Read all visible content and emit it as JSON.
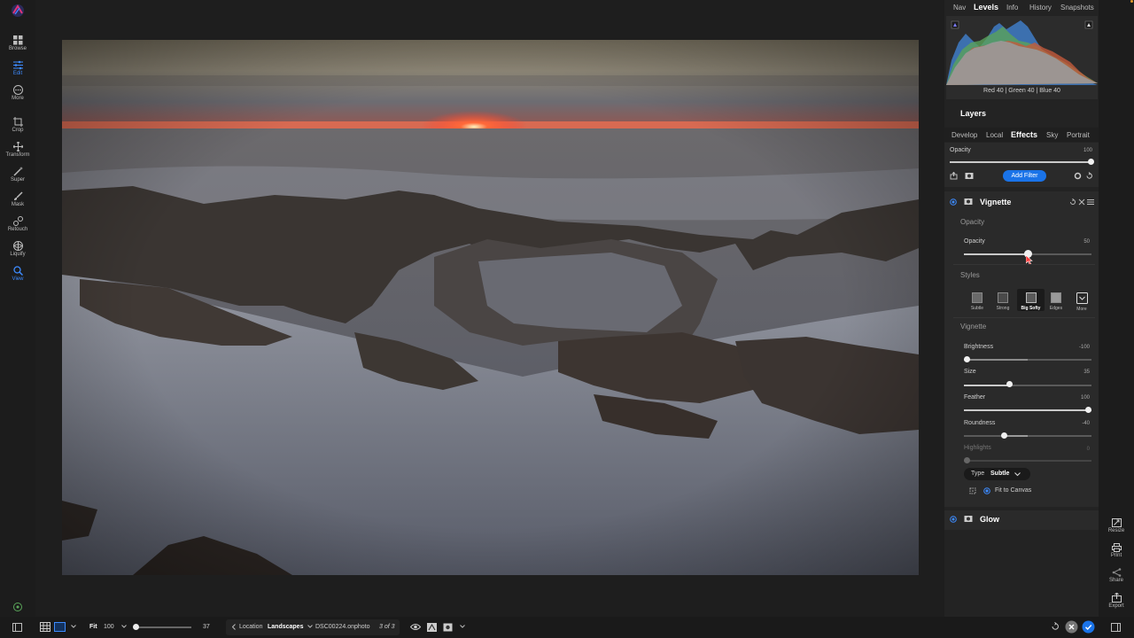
{
  "left_tools": [
    {
      "label": "Browse",
      "icon": "grid-icon"
    },
    {
      "label": "Edit",
      "icon": "sliders-icon",
      "active": true
    },
    {
      "label": "More",
      "icon": "ellipsis-circle-icon"
    },
    {
      "label": "Crop",
      "icon": "crop-icon"
    },
    {
      "label": "Transform",
      "icon": "move-icon"
    },
    {
      "label": "Super",
      "icon": "magic-wand-icon"
    },
    {
      "label": "Mask",
      "icon": "brush-icon"
    },
    {
      "label": "Retouch",
      "icon": "retouch-icon"
    },
    {
      "label": "Liquify",
      "icon": "liquify-icon"
    },
    {
      "label": "View",
      "icon": "magnifier-icon",
      "active": true
    }
  ],
  "top_tabs": [
    {
      "label": "Nav"
    },
    {
      "label": "Levels",
      "active": true
    },
    {
      "label": "Info"
    },
    {
      "label": "History"
    },
    {
      "label": "Snapshots"
    }
  ],
  "histogram": {
    "readout": "Red  40  | Green  40  | Blue  40"
  },
  "layers_title": "Layers",
  "module_tabs": [
    {
      "label": "Develop"
    },
    {
      "label": "Local"
    },
    {
      "label": "Effects",
      "active": true
    },
    {
      "label": "Sky"
    },
    {
      "label": "Portrait"
    }
  ],
  "filter_opacity": {
    "label": "Opacity",
    "value": "100",
    "level": 1.0
  },
  "add_filter_label": "Add Filter",
  "vignette": {
    "title": "Vignette",
    "opacity_section": "Opacity",
    "opacity": {
      "label": "Opacity",
      "value": "50",
      "level": 0.5
    },
    "styles_section": "Styles",
    "styles": [
      {
        "label": "Subtle"
      },
      {
        "label": "Strong"
      },
      {
        "label": "Big Softy",
        "selected": true
      },
      {
        "label": "Edges"
      },
      {
        "label": "More"
      }
    ],
    "vignette_section": "Vignette",
    "sliders": [
      {
        "label": "Brightness",
        "value": "-100",
        "level": 0.0
      },
      {
        "label": "Size",
        "value": "35",
        "level": 0.35
      },
      {
        "label": "Feather",
        "value": "100",
        "level": 1.0
      },
      {
        "label": "Roundness",
        "value": "-40",
        "level": 0.3
      },
      {
        "label": "Highlights",
        "value": "0",
        "level": 0.0,
        "disabled": true
      }
    ],
    "type_label": "Type",
    "type_value": "Subtle",
    "fit_to_canvas": "Fit to Canvas"
  },
  "glow_title": "Glow",
  "right_actions": [
    {
      "label": "Resize",
      "icon": "resize-icon"
    },
    {
      "label": "Print",
      "icon": "printer-icon"
    },
    {
      "label": "Share",
      "icon": "share-icon"
    },
    {
      "label": "Export",
      "icon": "export-icon"
    }
  ],
  "bottom": {
    "fit_label": "Fit",
    "zoom_value": "100",
    "thumb_size": "37",
    "location_label": "Location",
    "location_value": "Landscapes",
    "filename": "DSC00224.onphoto",
    "position": "3 of 3"
  },
  "colors": {
    "accent": "#1a73e8",
    "panel": "#2a2a2a",
    "background": "#1e1e1e"
  }
}
